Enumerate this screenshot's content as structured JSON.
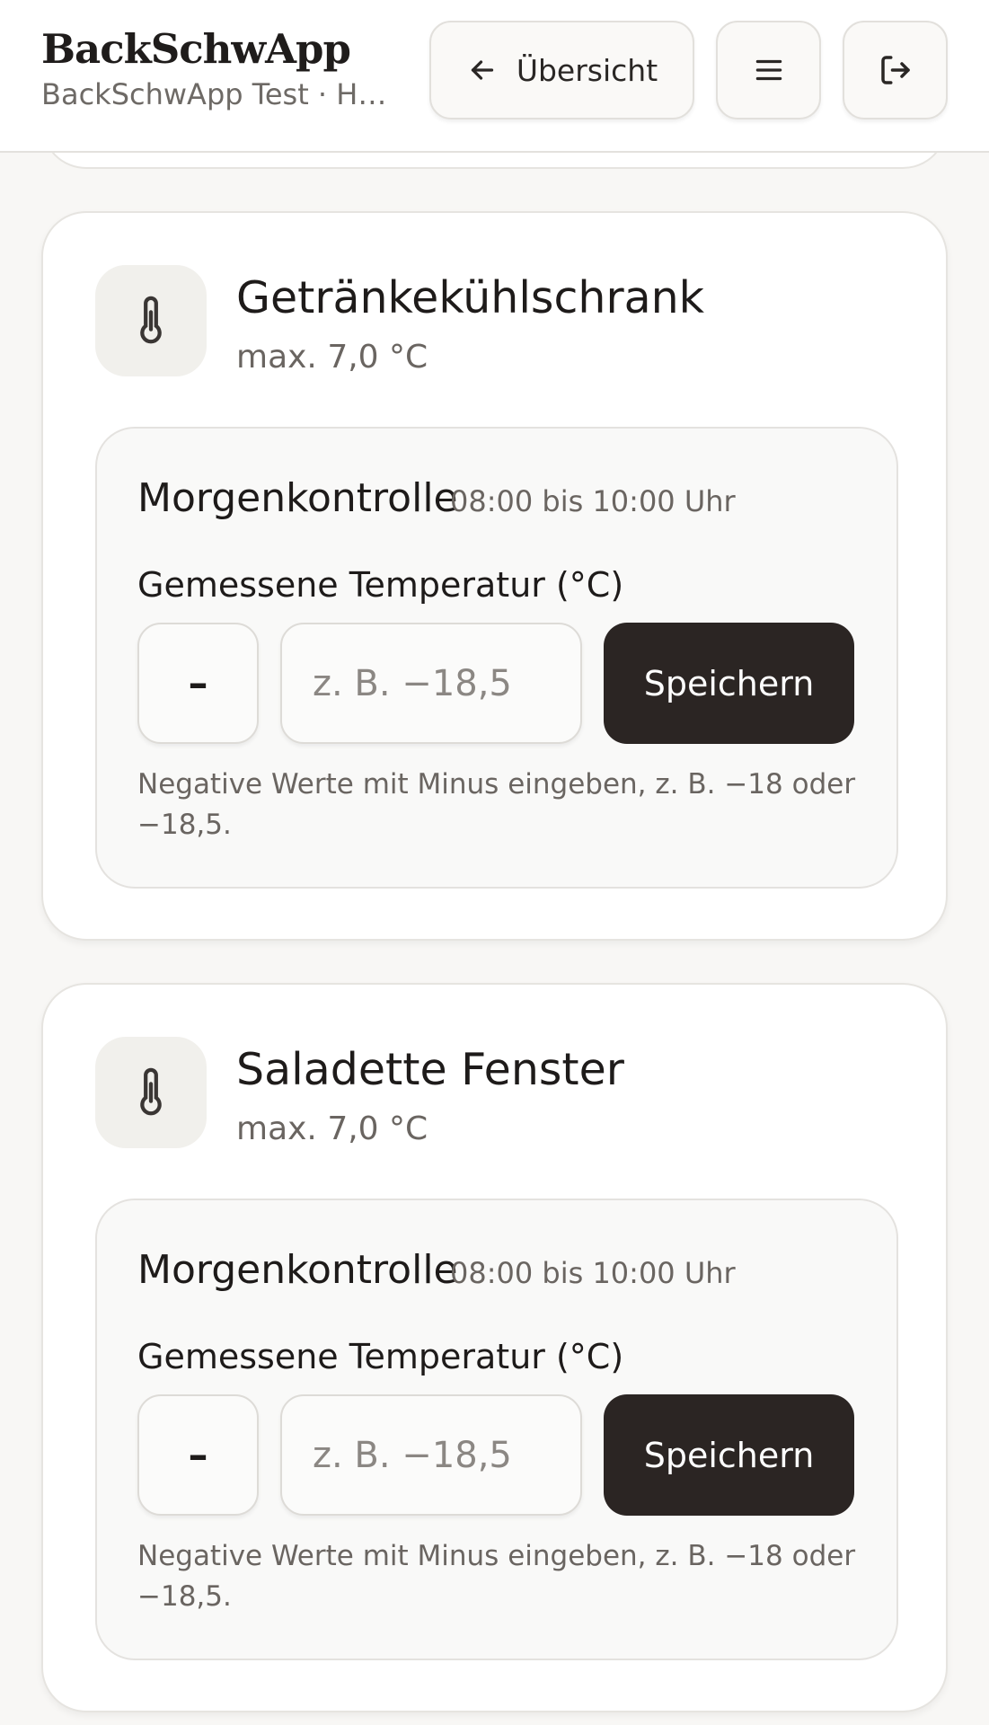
{
  "header": {
    "title": "BackSchwApp",
    "subtitle": "BackSchwApp Test · Ha...",
    "back_label": "Übersicht",
    "icons": {
      "back": "arrow-left-icon",
      "menu": "hamburger-menu-icon",
      "logout": "logout-icon"
    }
  },
  "units": [
    {
      "name": "Getränkekühlschrank",
      "max": "max. 7,0 °C",
      "icon": "thermometer-icon",
      "check": {
        "name": "Morgenkontrolle",
        "time": "08:00 bis 10:00 Uhr",
        "field_label": "Gemessene Temperatur (°C)",
        "minus_label": "–",
        "placeholder": "z. B. −18,5",
        "value": "",
        "save_label": "Speichern",
        "hint": "Negative Werte mit Minus eingeben, z. B. −18 oder −18,5."
      }
    },
    {
      "name": "Saladette Fenster",
      "max": "max. 7,0 °C",
      "icon": "thermometer-icon",
      "check": {
        "name": "Morgenkontrolle",
        "time": "08:00 bis 10:00 Uhr",
        "field_label": "Gemessene Temperatur (°C)",
        "minus_label": "–",
        "placeholder": "z. B. −18,5",
        "value": "",
        "save_label": "Speichern",
        "hint": "Negative Werte mit Minus eingeben, z. B. −18 oder −18,5."
      }
    }
  ],
  "colors": {
    "background": "#f8f7f5",
    "card": "#ffffff",
    "primary_button": "#2b2523",
    "icon_tile": "#f1f0ec",
    "muted_text": "#6a6561"
  }
}
